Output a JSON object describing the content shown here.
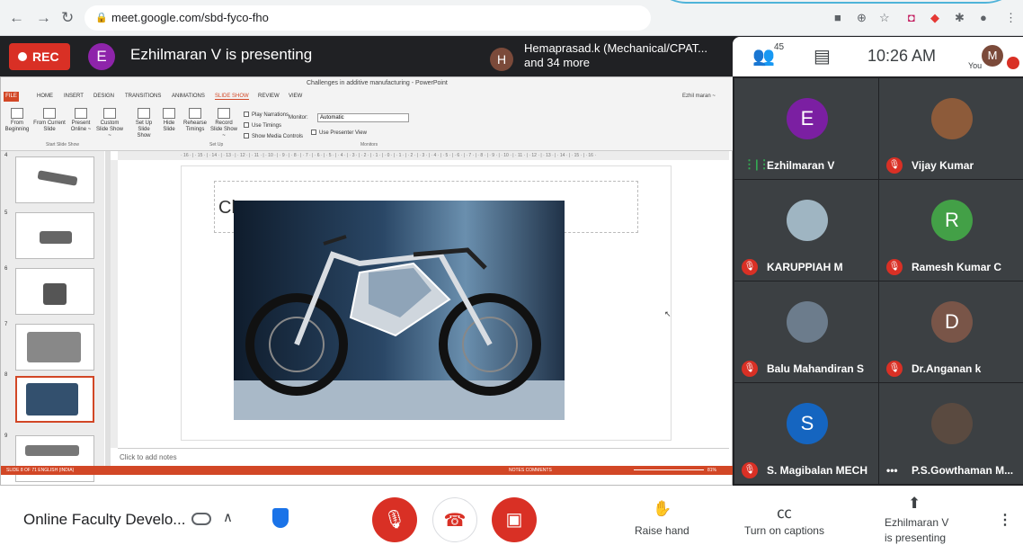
{
  "browser": {
    "url": "meet.google.com/sbd-fyco-fho"
  },
  "header": {
    "rec_label": "REC",
    "presenter_initial": "E",
    "presenter_text": "Ezhilmaran V is presenting",
    "other_initial": "H",
    "other_line1": "Hemaprasad.k (Mechanical/CPAT...",
    "other_line2": "and 34 more",
    "participant_count": "45",
    "time": "10:26 AM",
    "you_label": "You",
    "me_initial": "M"
  },
  "powerpoint": {
    "title": "Challenges in additive manufacturing - PowerPoint",
    "user": "Ezhil maran ~",
    "file_tab": "FILE",
    "tabs": [
      "HOME",
      "INSERT",
      "DESIGN",
      "TRANSITIONS",
      "ANIMATIONS",
      "SLIDE SHOW",
      "REVIEW",
      "VIEW"
    ],
    "ribbon_buttons": [
      "From Beginning",
      "From Current Slide",
      "Present Online ~",
      "Custom Slide Show ~",
      "Set Up Slide Show",
      "Hide Slide",
      "Rehearse Timings",
      "Record Slide Show ~"
    ],
    "checkboxes": [
      "Play Narrations",
      "Use Timings",
      "Show Media Controls"
    ],
    "monitor_label": "Monitor:",
    "monitor_value": "Automatic",
    "presenter_view": "Use Presenter View",
    "groups": [
      "Start Slide Show",
      "Set Up",
      "Monitors"
    ],
    "ruler_text": "· 16 · | · 15 · | · 14 · | · 13 · | · 12 · | · 11 · | · 10 · | · 9 · | · 8 · | · 7 · | · 6 · | · 5 · | · 4 · | · 3 · | · 2 · | · 1 · | · 0 · | · 1 · | · 2 · | · 3 · | · 4 · | · 5 · | · 6 · | · 7 · | · 8 · | · 9 · | · 10 · | · 11 · | · 12 · | · 13 · | · 14 · | · 15 · | · 16 ·",
    "slide_numbers": [
      "4",
      "5",
      "6",
      "7",
      "8",
      "9"
    ],
    "placeholder_text": "Cl",
    "notes_placeholder": "Click to add notes",
    "status_left": "SLIDE 8 OF 71    ENGLISH (INDIA)",
    "status_right": "NOTES   COMMENTS",
    "zoom": "81%"
  },
  "participants": [
    {
      "name": "Ezhilmaran V",
      "initial": "E",
      "color": "#7b1fa2",
      "status": "speaking"
    },
    {
      "name": "Vijay Kumar",
      "initial": "",
      "color": "#8d5b3a",
      "status": "muted"
    },
    {
      "name": "KARUPPIAH M",
      "initial": "",
      "color": "#9fb5c2",
      "status": "muted"
    },
    {
      "name": "Ramesh Kumar C",
      "initial": "R",
      "color": "#43a047",
      "status": "muted"
    },
    {
      "name": "Balu Mahandiran S",
      "initial": "",
      "color": "#6c7c8c",
      "status": "muted"
    },
    {
      "name": "Dr.Anganan k",
      "initial": "D",
      "color": "#795548",
      "status": "muted"
    },
    {
      "name": "S. Magibalan MECH",
      "initial": "S",
      "color": "#1565c0",
      "status": "muted"
    },
    {
      "name": "P.S.Gowthaman M...",
      "initial": "",
      "color": "#5a4a40",
      "status": "more"
    }
  ],
  "bottom": {
    "meeting_name": "Online Faculty Develo...",
    "raise_hand": "Raise hand",
    "captions": "Turn on captions",
    "presenting_line1": "Ezhilmaran V",
    "presenting_line2": "is presenting"
  },
  "colors": {
    "accent_red": "#d93025",
    "ppt_orange": "#d24726",
    "meet_dark": "#202124"
  }
}
